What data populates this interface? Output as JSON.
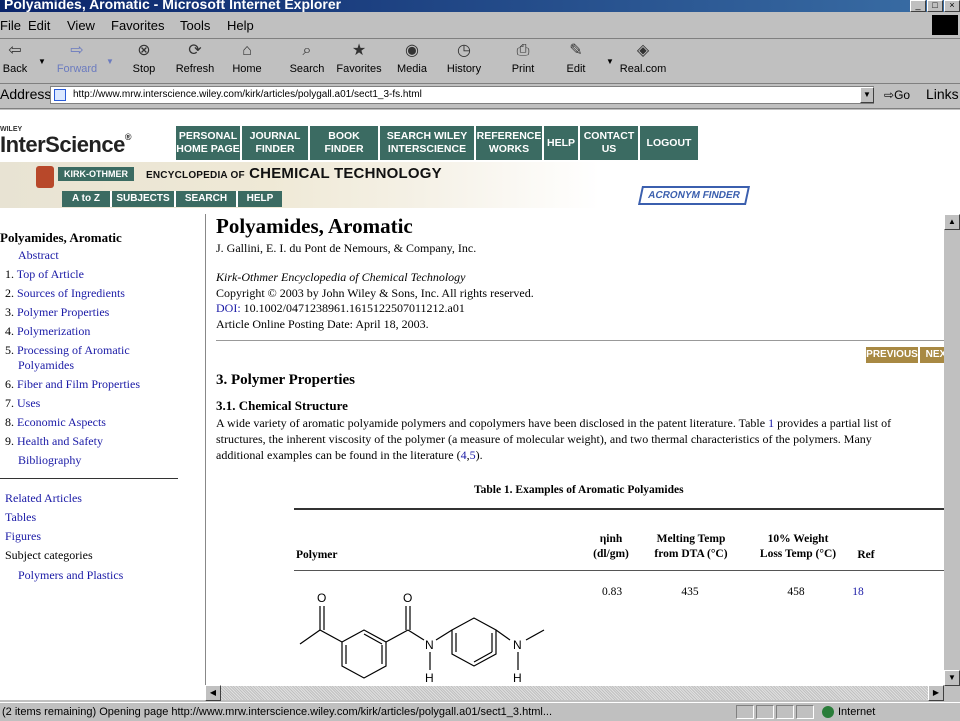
{
  "window": {
    "title": "Polyamides, Aromatic - Microsoft Internet Explorer"
  },
  "menu": [
    "File",
    "Edit",
    "View",
    "Favorites",
    "Tools",
    "Help"
  ],
  "toolbar": {
    "back": "Back",
    "forward": "Forward",
    "stop": "Stop",
    "refresh": "Refresh",
    "home": "Home",
    "search": "Search",
    "favorites": "Favorites",
    "media": "Media",
    "history": "History",
    "print": "Print",
    "edit": "Edit",
    "real": "Real.com"
  },
  "address": {
    "label": "Address",
    "url": "http://www.mrw.interscience.wiley.com/kirk/articles/polygall.a01/sect1_3-fs.html",
    "go": "Go",
    "links": "Links"
  },
  "header": {
    "wiley": "WILEY",
    "brand": "InterScience",
    "nav": [
      "PERSONAL HOME PAGE",
      "JOURNAL FINDER",
      "BOOK FINDER",
      "SEARCH WILEY INTERSCIENCE",
      "REFERENCE WORKS",
      "HELP",
      "CONTACT US",
      "LOGOUT"
    ],
    "kirk_label": "KIRK-OTHMER",
    "encyclopedia_pre": "ENCYCLOPEDIA OF",
    "encyclopedia": "CHEMICAL TECHNOLOGY",
    "sub_nav": [
      "A to Z",
      "SUBJECTS",
      "SEARCH",
      "HELP"
    ],
    "acronym": "ACRONYM FINDER"
  },
  "sidebar": {
    "title": "Polyamides, Aromatic",
    "abstract": "Abstract",
    "items": [
      {
        "num": "1.",
        "label": "Top of Article"
      },
      {
        "num": "2.",
        "label": "Sources of Ingredients"
      },
      {
        "num": "3.",
        "label": "Polymer Properties"
      },
      {
        "num": "4.",
        "label": "Polymerization"
      },
      {
        "num": "5.",
        "label": "Processing of Aromatic",
        "label2": "Polyamides"
      },
      {
        "num": "6.",
        "label": "Fiber and Film Properties"
      },
      {
        "num": "7.",
        "label": "Uses"
      },
      {
        "num": "8.",
        "label": "Economic Aspects"
      },
      {
        "num": "9.",
        "label": "Health and Safety"
      }
    ],
    "bibliography": "Bibliography",
    "related": "Related Articles",
    "tables": "Tables",
    "figures": "Figures",
    "subject_categories": "Subject categories",
    "polymers": "Polymers and Plastics"
  },
  "article": {
    "title": "Polyamides, Aromatic",
    "author": "J. Gallini, E. I. du Pont de Nemours, & Company, Inc.",
    "source": "Kirk-Othmer Encyclopedia of Chemical Technology",
    "copyright": "Copyright © 2003 by John Wiley & Sons, Inc. All rights reserved.",
    "doi_label": "DOI:",
    "doi": " 10.1002/0471238961.1615122507011212.a01",
    "posted": "Article Online Posting Date: April 18, 2003.",
    "previous": "PREVIOUS",
    "next": "NEXT",
    "section": "3. Polymer Properties",
    "subsection": "3.1. Chemical Structure",
    "p1a": "A wide variety of aromatic polyamide polymers and copolymers have been disclosed in the patent literature. Table ",
    "p1link": "1",
    "p1b": " provides a partial list of",
    "p2": "structures, the inherent viscosity of the polymer (a measure of molecular weight), and two thermal characteristics of the polymers. Many",
    "p3a": "additional examples can be found in the literature (",
    "p3l1": "4",
    "p3sep": ",",
    "p3l2": "5",
    "p3b": ")."
  },
  "table": {
    "caption": "Table 1. Examples of Aromatic Polyamides",
    "headers": {
      "polymer": "Polymer",
      "inh1": "ηinh",
      "inh2": "(dl/gm)",
      "melt1": "Melting Temp",
      "melt2": "from DTA (°C)",
      "loss1": "10% Weight",
      "loss2": "Loss Temp (°C)",
      "ref": "Ref"
    },
    "row1": {
      "inh": "0.83",
      "melt": "435",
      "loss": "458",
      "ref": "18"
    },
    "atoms": {
      "o": "O",
      "n": "N",
      "h": "H"
    }
  },
  "status": {
    "text": "(2 items remaining) Opening page http://www.mrw.interscience.wiley.com/kirk/articles/polygall.a01/sect1_3.html...",
    "zone": "Internet"
  },
  "colors": {
    "nav_green": "#3b6b62",
    "nav_gold": "#a88943",
    "link_blue": "#1a1aa6",
    "acronym_blue": "#3b5fae"
  }
}
